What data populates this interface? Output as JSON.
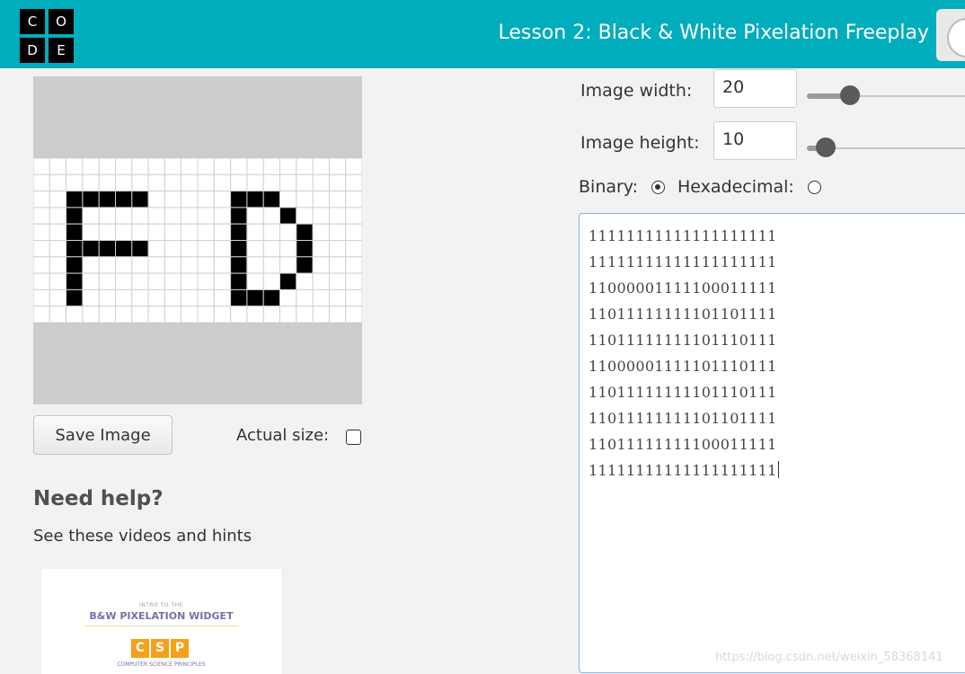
{
  "header": {
    "logo_letters": [
      "C",
      "O",
      "D",
      "E"
    ],
    "lesson_title": "Lesson 2: Black & White Pixelation Freeplay"
  },
  "controls": {
    "width_label": "Image width:",
    "width_value": "20",
    "width_slider_level": 0.27,
    "height_label": "Image height:",
    "height_value": "10",
    "height_slider_level": 0.12,
    "binary_label": "Binary:",
    "binary_selected": true,
    "hex_label": "Hexadecimal:",
    "hex_selected": false
  },
  "pixel_grid": {
    "columns": 20,
    "rows": 10,
    "on_color": "#ffffff",
    "off_color": "#000000",
    "bits": [
      "11111111111111111111",
      "11111111111111111111",
      "11000001111100011111",
      "11011111111101101111",
      "11011111111101110111",
      "11000001111101110111",
      "11011111111101110111",
      "11011111111101101111",
      "11011111111100011111",
      "11111111111111111111"
    ]
  },
  "left_panel": {
    "save_label": "Save Image",
    "actual_size_label": "Actual size:",
    "actual_size_checked": false
  },
  "help": {
    "title": "Need help?",
    "subtitle": "See these videos and hints",
    "video": {
      "small_heading": "INTRO TO THE",
      "widget_title": "B&W PIXELATION WIDGET",
      "csp_letters": [
        "C",
        "S",
        "P"
      ],
      "csp_caption": "COMPUTER SCIENCE PRINCIPLES"
    }
  },
  "watermark": "https://blog.csdn.net/weixin_58368141",
  "colors": {
    "header": "#00adbc",
    "accent_orange": "#f6a01a",
    "purple": "#7b6ea8"
  }
}
